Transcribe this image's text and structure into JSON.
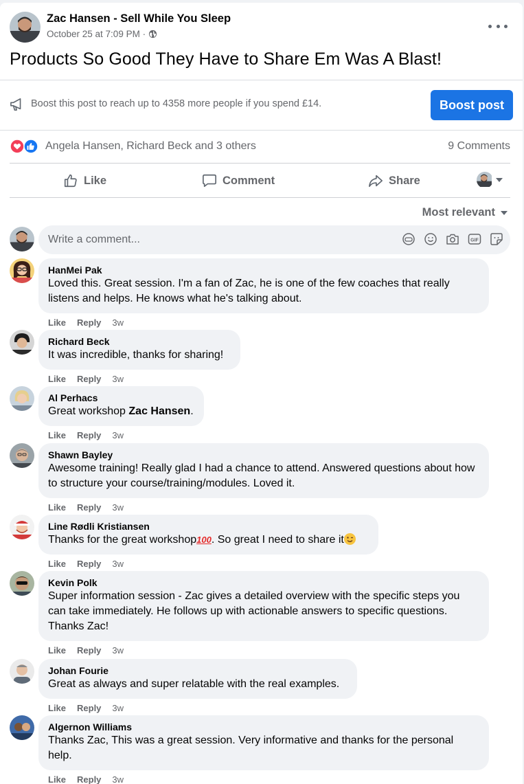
{
  "post": {
    "author": "Zac Hansen - Sell While You Sleep",
    "timestamp": "October 25 at 7:09 PM ·",
    "text": "Products So Good They Have to Share Em Was A Blast!",
    "privacy_icon": "globe-icon"
  },
  "boost": {
    "message": "Boost this post to reach up to 4358 more people if you spend £14.",
    "button_label": "Boost post"
  },
  "reactions": {
    "names": "Angela Hansen, Richard Beck and 3 others",
    "comments_count": "9 Comments",
    "icons": [
      "love-icon",
      "like-icon"
    ]
  },
  "actions": {
    "like": "Like",
    "comment": "Comment",
    "share": "Share"
  },
  "sort_label": "Most relevant",
  "composer": {
    "placeholder": "Write a comment..."
  },
  "comments": [
    {
      "name": "HanMei Pak",
      "text": "Loved this. Great session. I'm a fan of Zac, he is one of the few coaches that really listens and helps. He knows what he's talking about.",
      "like": "Like",
      "reply": "Reply",
      "age": "3w"
    },
    {
      "name": "Richard Beck",
      "text": "It was incredible, thanks for sharing!",
      "like": "Like",
      "reply": "Reply",
      "age": "3w"
    },
    {
      "name": "Al Perhacs",
      "text_before": "Great workshop ",
      "mention": "Zac Hansen",
      "text_after": ".",
      "like": "Like",
      "reply": "Reply",
      "age": "3w"
    },
    {
      "name": "Shawn Bayley",
      "text": "Awesome training! Really glad I had a chance to attend. Answered questions about how to structure your course/training/modules. Loved it.",
      "like": "Like",
      "reply": "Reply",
      "age": "3w"
    },
    {
      "name": "Line Rødli Kristiansen",
      "text_before": "Thanks for the great workshop",
      "emoji_100": "100",
      "text_mid": ". So great I need to share it",
      "like": "Like",
      "reply": "Reply",
      "age": "3w"
    },
    {
      "name": "Kevin Polk",
      "text": "Super information session - Zac gives a detailed overview with the specific steps you can take immediately. He follows up with actionable answers to specific questions. Thanks Zac!",
      "like": "Like",
      "reply": "Reply",
      "age": "3w"
    },
    {
      "name": "Johan Fourie",
      "text": "Great as always and super relatable with the real examples.",
      "like": "Like",
      "reply": "Reply",
      "age": "3w"
    },
    {
      "name": "Algernon Williams",
      "text": "Thanks Zac, This was a great session. Very informative and thanks for the personal help.",
      "like": "Like",
      "reply": "Reply",
      "age": "3w"
    }
  ]
}
